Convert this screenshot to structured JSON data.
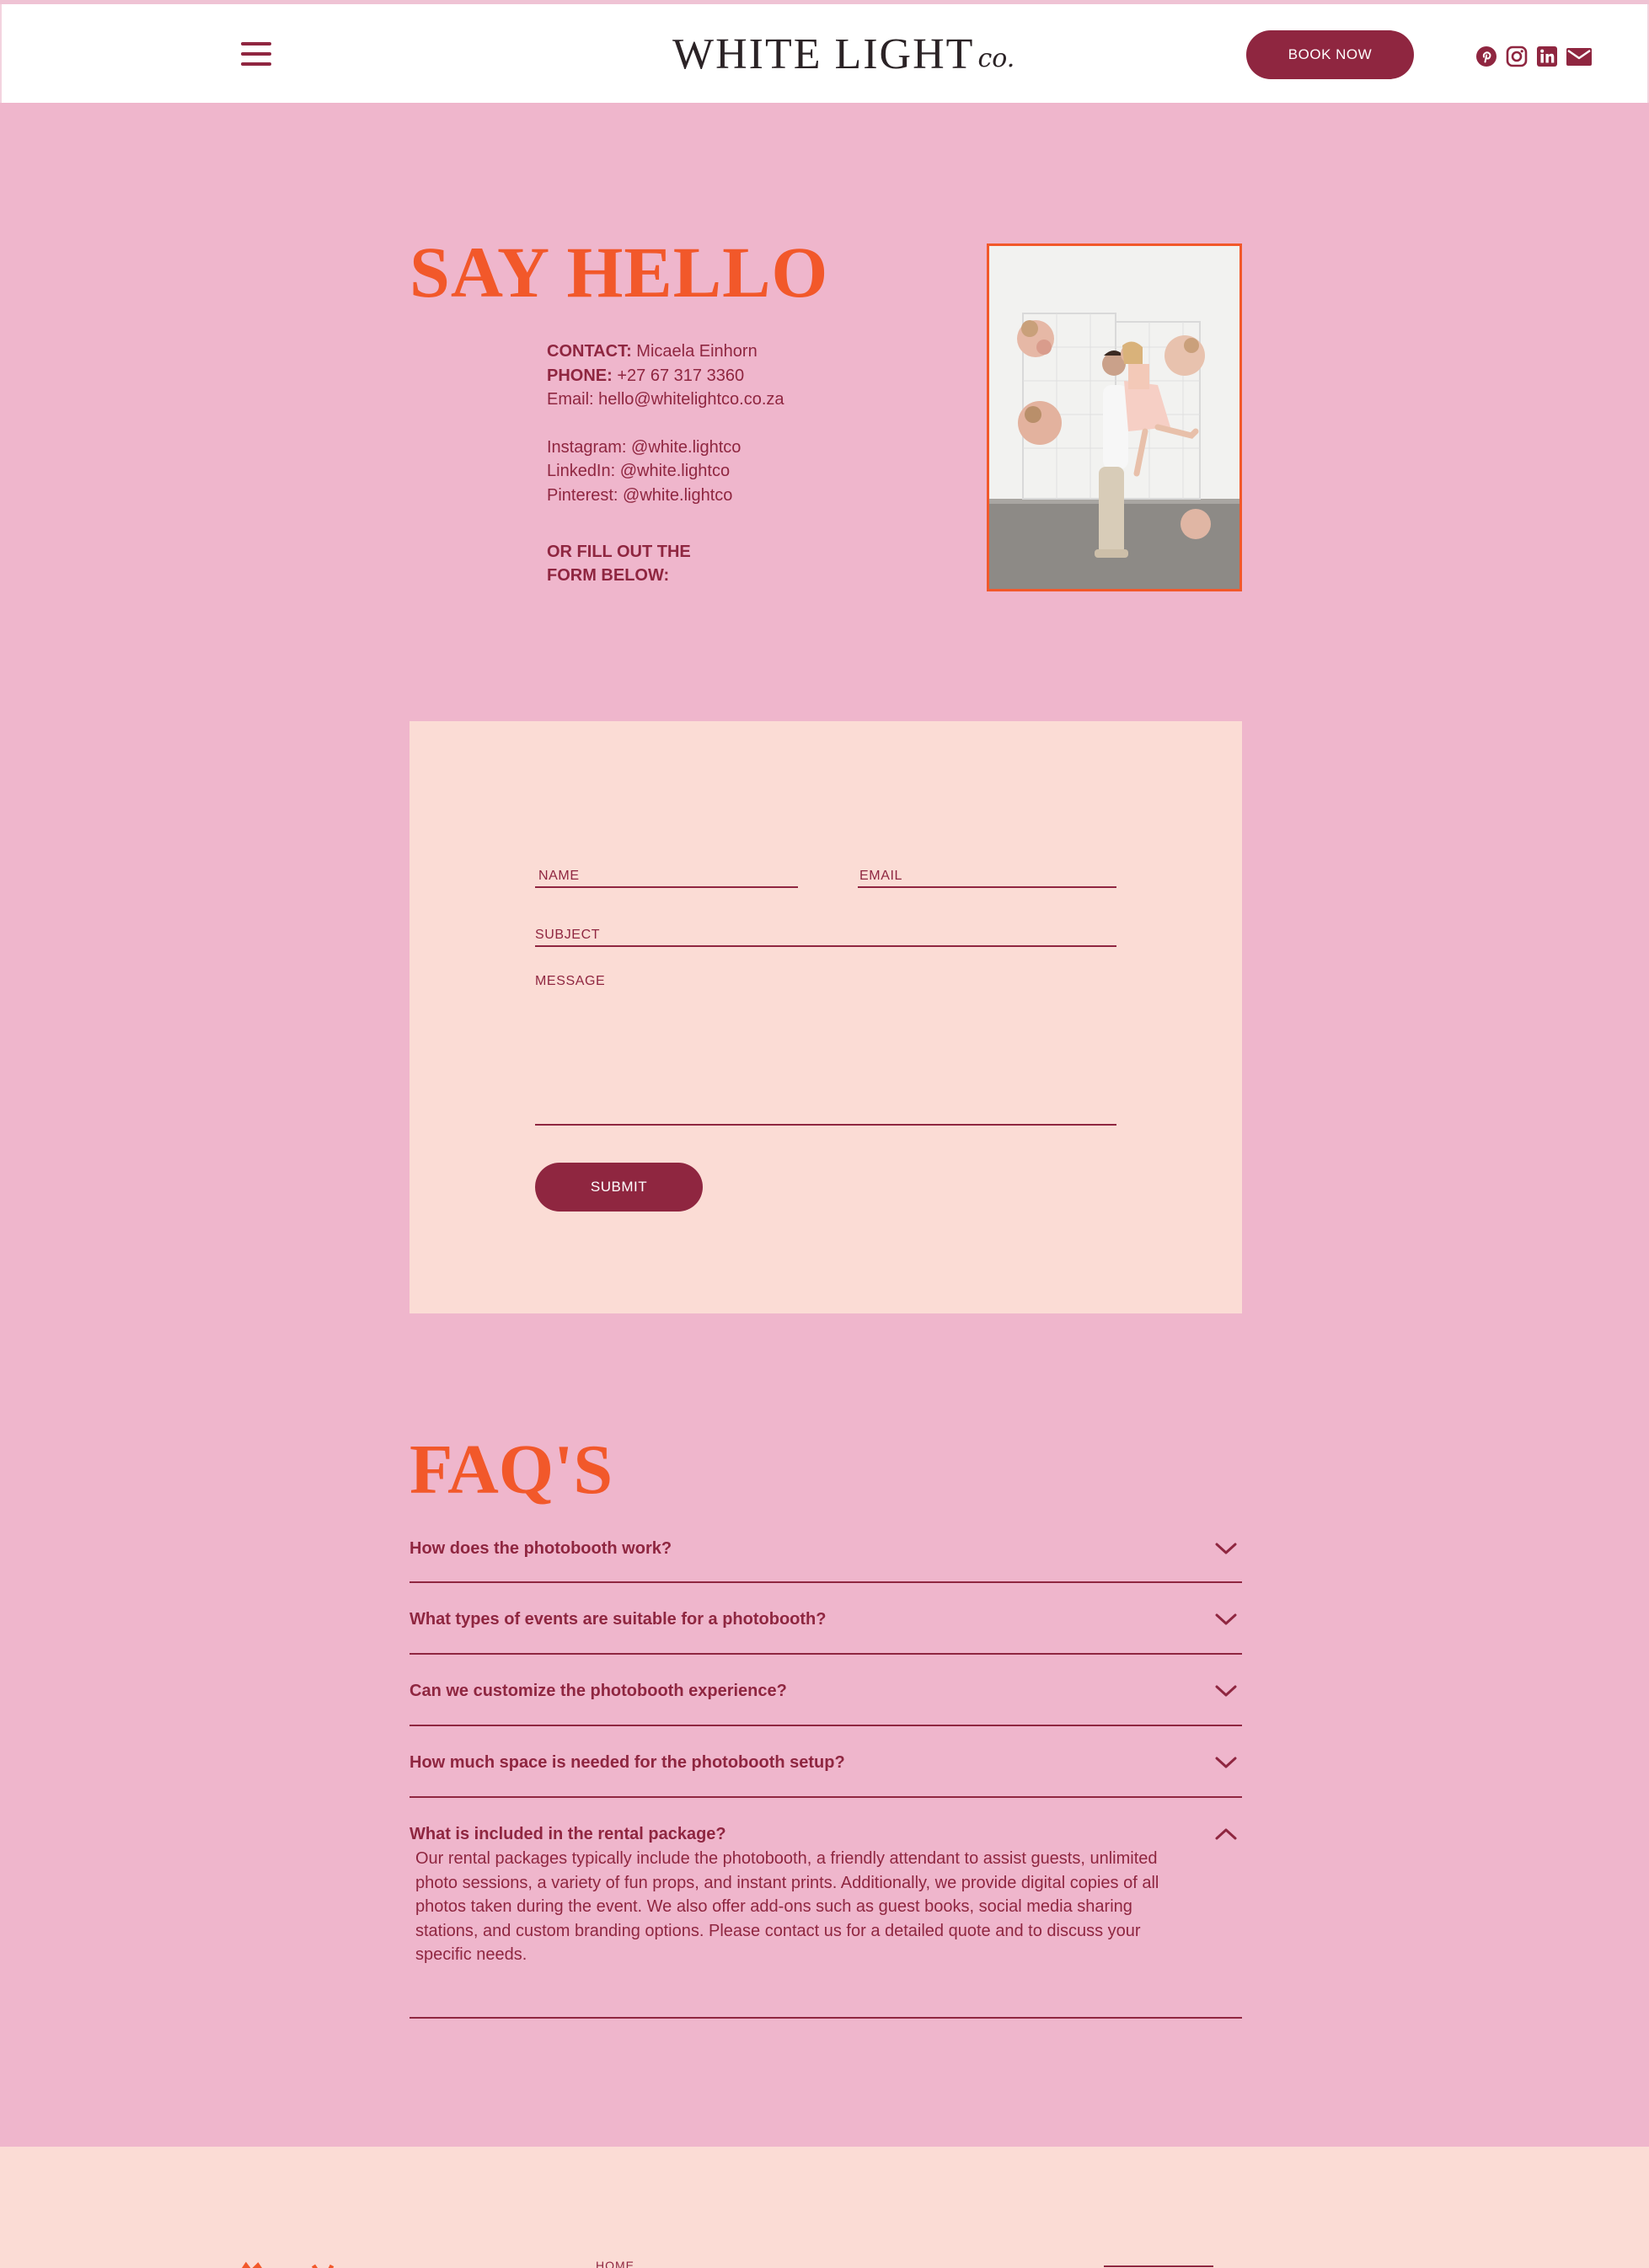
{
  "colors": {
    "page_bg": "#efb6cc",
    "header_bg": "#ffffff",
    "accent_orange": "#f2582a",
    "brand_maroon": "#8f2640",
    "card_bg": "#fbdcd5"
  },
  "header": {
    "menu_icon": "hamburger-icon",
    "logo_main": "WHITE LIGHT",
    "logo_script": "co.",
    "book_now_label": "BOOK NOW",
    "social_icons": [
      "pinterest-icon",
      "instagram-icon",
      "linkedin-icon",
      "mail-icon"
    ]
  },
  "hello": {
    "title": "SAY HELLO",
    "contact_label": "CONTACT:",
    "contact_value": "Micaela Einhorn",
    "phone_label": "PHONE:",
    "phone_value": "+27 67 317 3360",
    "email": "Email: hello@whitelightco.co.za",
    "instagram": "Instagram: @white.lightco",
    "linkedin": "LinkedIn: @white.lightco",
    "pinterest": "Pinterest: @white.lightco",
    "cta_line1": "OR FILL OUT THE",
    "cta_line2": "FORM BELOW:"
  },
  "form": {
    "name_label": "NAME",
    "email_label": "EMAIL",
    "subject_label": "SUBJECT",
    "message_label": "MESSAGE",
    "submit_label": "SUBMIT"
  },
  "faq": {
    "title": "FAQ'S",
    "items": [
      {
        "question": "How does the photobooth work?",
        "expanded": false
      },
      {
        "question": "What types of events are suitable for a photobooth?",
        "expanded": false
      },
      {
        "question": "Can we customize the photobooth experience?",
        "expanded": false
      },
      {
        "question": "How much space is needed for the photobooth setup?",
        "expanded": false
      },
      {
        "question": "What is included in the rental package?",
        "expanded": true,
        "answer": "Our rental packages typically include the photobooth, a friendly attendant to assist guests, unlimited photo sessions, a variety of fun props, and instant prints. Additionally, we provide digital copies of all photos taken during the event. We also offer add-ons such as guest books, social media sharing stations, and custom branding options. Please contact us for a detailed quote and to discuss your specific needs."
      }
    ]
  },
  "footer": {
    "nav_home": "HOME"
  }
}
